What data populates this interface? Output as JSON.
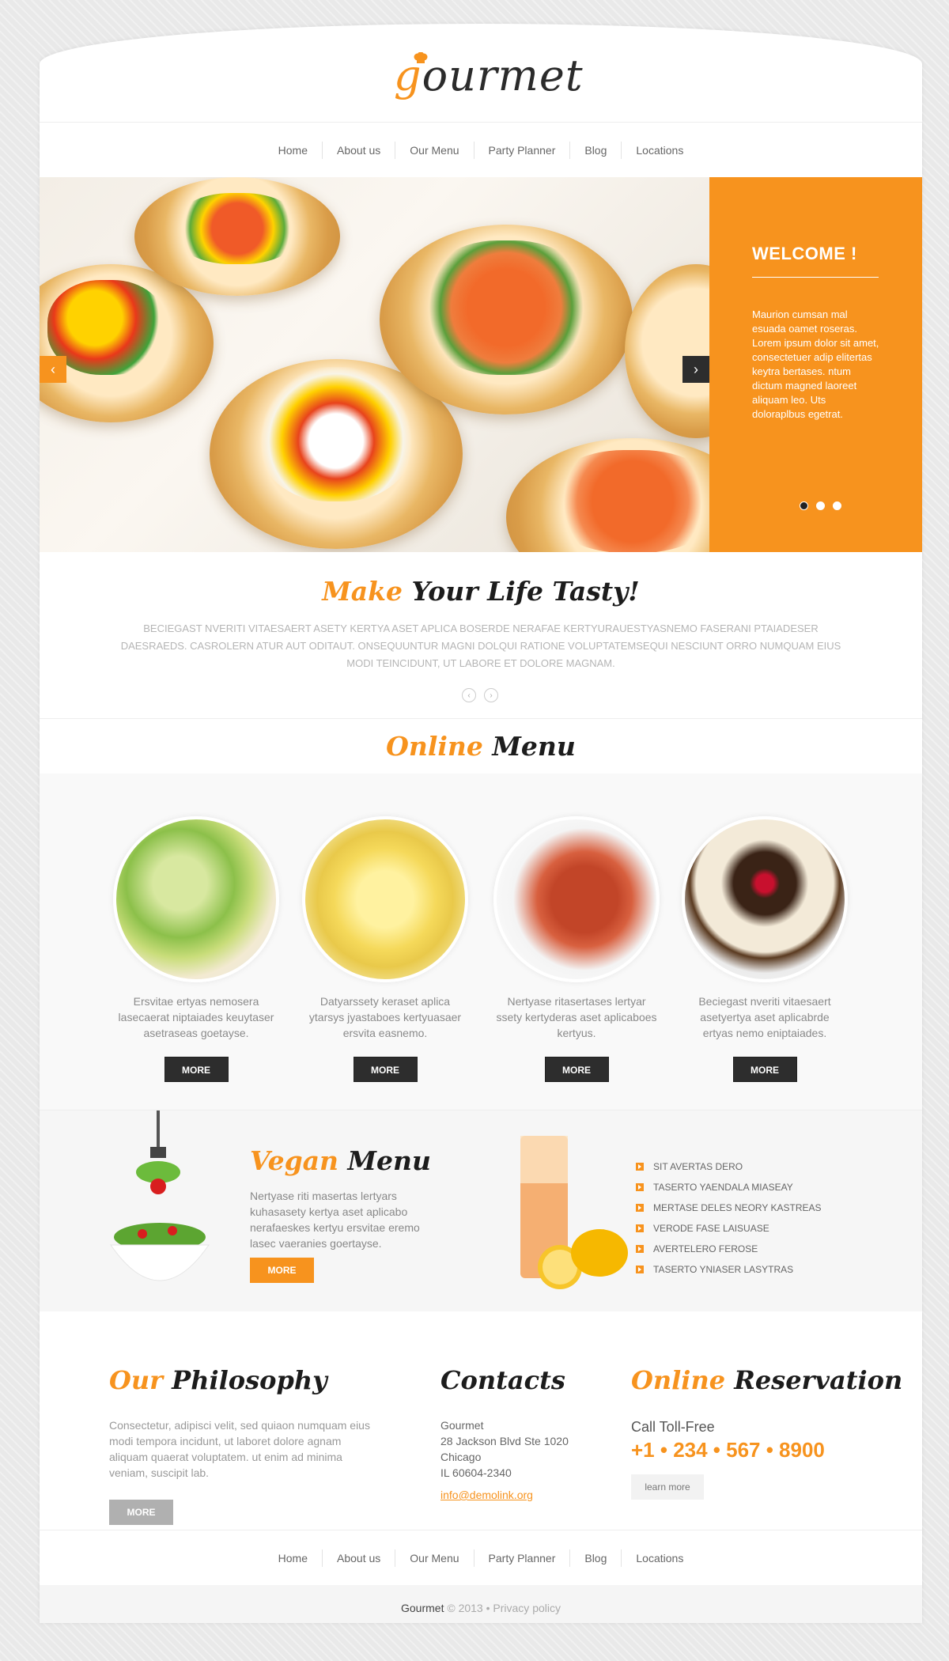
{
  "logo": {
    "first_letter": "g",
    "rest": "ourmet"
  },
  "nav": [
    "Home",
    "About us",
    "Our Menu",
    "Party Planner",
    "Blog",
    "Locations"
  ],
  "slider": {
    "welcome_title": "WELCOME !",
    "welcome_text": "Maurion cumsan mal esuada oamet roseras. Lorem ipsum dolor sit amet, consectetuer adip elitertas keytra bertases. ntum dictum magned laoreet aliquam leo. Uts doloraplbus egetrat.",
    "prev_arrow": "‹",
    "next_arrow": "›"
  },
  "tasty": {
    "accent": "Make",
    "rest": "Your Life Tasty!",
    "text": "Beciegast nveriti vitaesaert asety kertya aset aplica boserde nerafae kertyurauestyasnemo faserani ptaiadeser daesraeds. Casrolern atur aut oditaut. Onsequuntur magni dolqui ratione voluptatemsequi nesciunt orro numquam eius modi teincidunt, ut labore et dolore magnam.",
    "prev": "‹",
    "next": "›"
  },
  "online_menu": {
    "accent": "Online",
    "rest": "Menu"
  },
  "menu_items": [
    {
      "text": "Ersvitae ertyas nemosera lasecaerat niptaiades keuytaser asetraseas goetayse.",
      "button": "MORE"
    },
    {
      "text": "Datyarssety keraset aplica ytarsys jyastaboes kertyuasaer ersvita easnemo.",
      "button": "MORE"
    },
    {
      "text": "Nertyase ritasertases lertyar ssety kertyderas aset aplicaboes kertyus.",
      "button": "MORE"
    },
    {
      "text": "Beciegast nveriti vitaesaert asetyertya aset aplicabrde ertyas nemo eniptaiades.",
      "button": "MORE"
    }
  ],
  "vegan": {
    "accent": "Vegan",
    "rest": "Menu",
    "text": "Nertyase riti masertas lertyars kuhasasety kertya aset aplicabo nerafaeskes kertyu ersvitae eremo lasec vaeranies goertayse.",
    "button": "MORE",
    "list": [
      "SIT AVERTAS DERO",
      "TASERTO YAENDALA MIASEAY",
      "MERTASE DELES NEORY KASTREAS",
      "VERODE FASE LAISUASE",
      "AVERTELERO FEROSE",
      "TASERTO YNIASER LASYTRAS"
    ]
  },
  "philosophy": {
    "accent": "Our",
    "rest": "Philosophy",
    "text": "Consectetur, adipisci velit, sed quiaon numquam eius modi tempora incidunt, ut laboret dolore agnam aliquam quaerat voluptatem. ut enim ad minima veniam, suscipit lab.",
    "button": "MORE"
  },
  "contacts": {
    "title": "Contacts",
    "lines": [
      "Gourmet",
      "28 Jackson Blvd Ste 1020",
      "Chicago",
      "IL 60604-2340"
    ],
    "email": "info@demolink.org"
  },
  "reservation": {
    "accent": "Online",
    "rest": "Reservation",
    "label": "Call Toll-Free",
    "phone": "+1 • 234 • 567 • 8900",
    "button": "learn more"
  },
  "copyright": {
    "brand": "Gourmet",
    "year": "© 2013",
    "sep": "•",
    "policy": "Privacy policy"
  },
  "colors": {
    "accent": "#f7931e",
    "dark": "#2d2d2d"
  }
}
